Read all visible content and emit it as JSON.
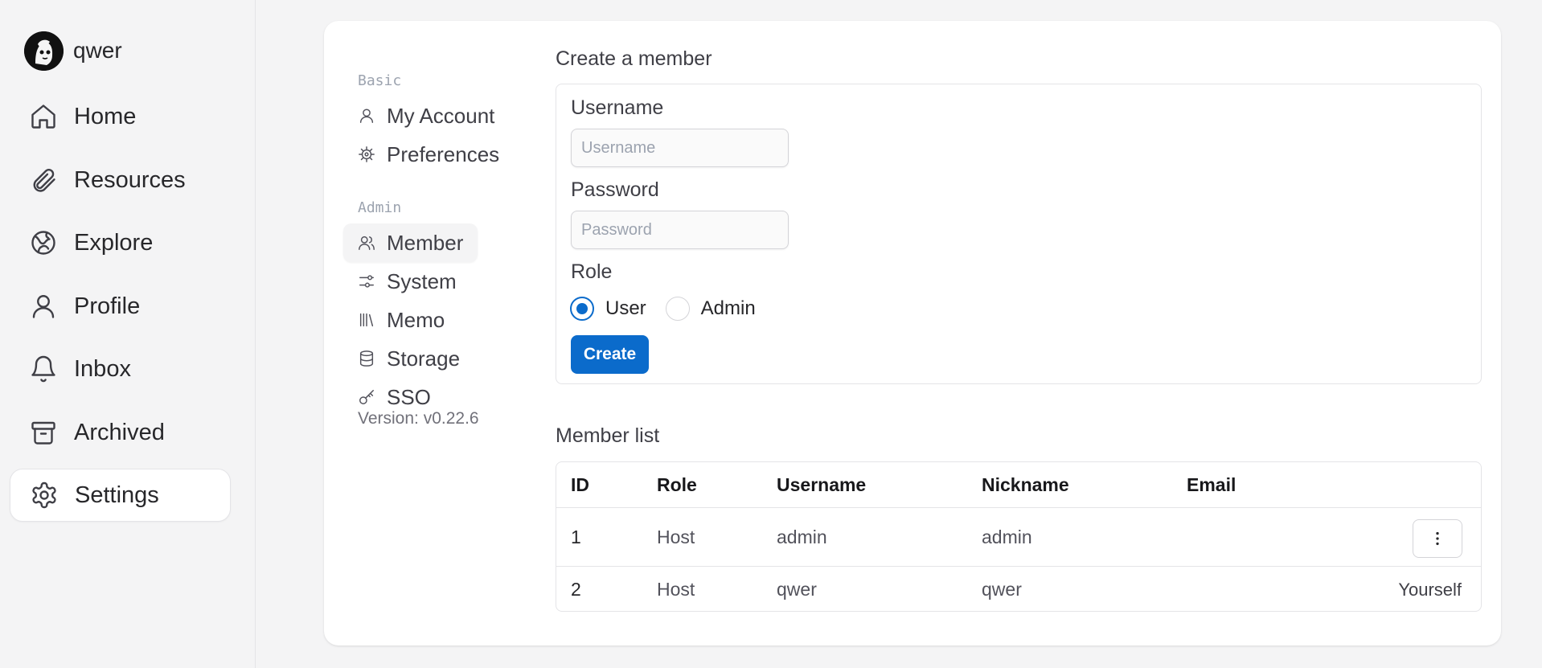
{
  "user": {
    "name": "qwer"
  },
  "sidebar": {
    "items": [
      {
        "label": "Home",
        "icon": "home-icon"
      },
      {
        "label": "Resources",
        "icon": "paperclip-icon"
      },
      {
        "label": "Explore",
        "icon": "globe-icon"
      },
      {
        "label": "Profile",
        "icon": "user-icon"
      },
      {
        "label": "Inbox",
        "icon": "bell-icon"
      },
      {
        "label": "Archived",
        "icon": "archive-icon"
      },
      {
        "label": "Settings",
        "icon": "gear-icon",
        "active": true
      }
    ]
  },
  "settings_nav": {
    "basic_label": "Basic",
    "admin_label": "Admin",
    "basic_items": [
      {
        "label": "My Account",
        "icon": "user-icon"
      },
      {
        "label": "Preferences",
        "icon": "cog-icon"
      }
    ],
    "admin_items": [
      {
        "label": "Member",
        "icon": "users-icon",
        "active": true
      },
      {
        "label": "System",
        "icon": "sliders-icon"
      },
      {
        "label": "Memo",
        "icon": "library-icon"
      },
      {
        "label": "Storage",
        "icon": "database-icon"
      },
      {
        "label": "SSO",
        "icon": "key-icon"
      }
    ],
    "version": "Version: v0.22.6"
  },
  "create_member": {
    "title": "Create a member",
    "username_label": "Username",
    "username_placeholder": "Username",
    "username_value": "",
    "password_label": "Password",
    "password_placeholder": "Password",
    "password_value": "",
    "role_label": "Role",
    "roles": [
      {
        "label": "User",
        "checked": true
      },
      {
        "label": "Admin",
        "checked": false
      }
    ],
    "create_label": "Create"
  },
  "member_list": {
    "title": "Member list",
    "columns": [
      "ID",
      "Role",
      "Username",
      "Nickname",
      "Email"
    ],
    "rows": [
      {
        "id": "1",
        "role": "Host",
        "username": "admin",
        "nickname": "admin",
        "email": "",
        "action": "more-menu"
      },
      {
        "id": "2",
        "role": "Host",
        "username": "qwer",
        "nickname": "qwer",
        "email": "",
        "action": "Yourself"
      }
    ]
  },
  "colors": {
    "primary": "#0b6bcb",
    "background": "#f4f4f5",
    "card": "#ffffff",
    "border": "#e4e4e7"
  }
}
